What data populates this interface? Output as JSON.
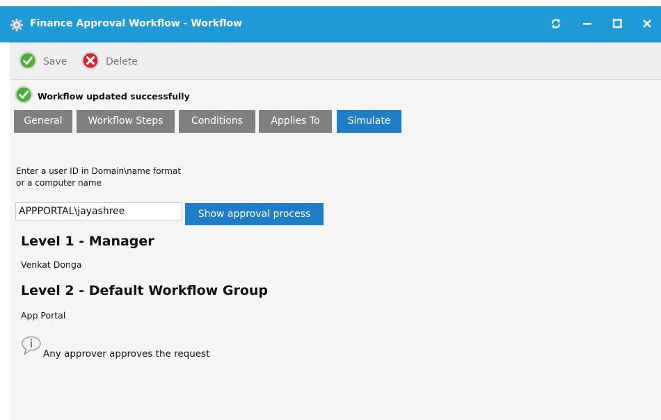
{
  "window": {
    "title": "Finance Approval Workflow - Workflow",
    "controls": [
      "refresh-icon",
      "minimize-icon",
      "maximize-icon",
      "close-icon"
    ]
  },
  "toolbar": {
    "save_label": "Save",
    "delete_label": "Delete"
  },
  "status": {
    "message": "Workflow updated successfully"
  },
  "tabs": [
    {
      "label": "General",
      "active": false
    },
    {
      "label": "Workflow Steps",
      "active": false
    },
    {
      "label": "Conditions",
      "active": false
    },
    {
      "label": "Applies To",
      "active": false
    },
    {
      "label": "Simulate",
      "active": true
    }
  ],
  "simulate": {
    "prompt_line1": "Enter a user ID in Domain\\name format",
    "prompt_line2": "or a computer name",
    "user_input_value": "APPPORTAL\\jayashree",
    "show_button_label": "Show approval process",
    "levels": [
      {
        "title": "Level 1 - Manager",
        "approver": "Venkat Donga"
      },
      {
        "title": "Level 2 - Default Workflow Group",
        "approver": "App Portal"
      }
    ],
    "note": "Any approver approves the request"
  },
  "colors": {
    "titlebar": "#1e9ad6",
    "tab_inactive": "#808080",
    "tab_active": "#1f7ec5",
    "button_primary": "#1f7ec5",
    "success_green": "#4caf3a",
    "delete_red": "#d0262e"
  }
}
